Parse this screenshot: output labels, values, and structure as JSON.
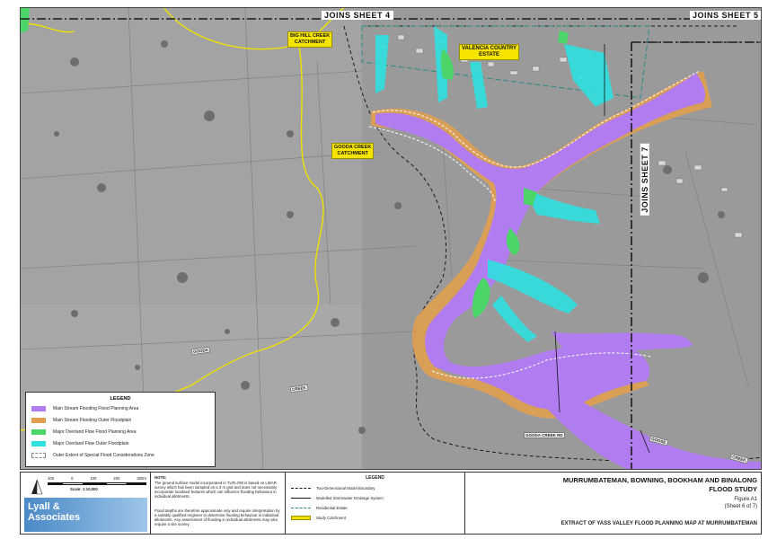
{
  "map": {
    "joins_top": "JOINS SHEET 4",
    "joins_top_right": "JOINS SHEET 5",
    "joins_right": "JOINS SHEET 7",
    "catchments": [
      "BIG HILL CREEK\nCATCHMENT",
      "GOODA CREEK\nCATCHMENT"
    ],
    "estate": "VALENCIA COUNTRY\nESTATE",
    "roads": [
      "GOODA",
      "CREEK",
      "GOODA CREEK RD",
      "GOOSE",
      "CREEK"
    ]
  },
  "legend": {
    "title": "LEGEND",
    "items": [
      {
        "label": "Main Stream Flooding Flood Planning Area",
        "color": "#b07cf0"
      },
      {
        "label": "Main Stream Flooding Outer Floodplain",
        "color": "#e0a050"
      },
      {
        "label": "Major Overland Flow Flood Planning Area",
        "color": "#4cd66a"
      },
      {
        "label": "Major Overland Flow Outer Floodplain",
        "color": "#2fe0e0"
      },
      {
        "label": "Outer Extent of Special Flood Considerations Zone",
        "color": "#ffffff"
      }
    ]
  },
  "footer": {
    "scale_ticks": [
      "100",
      "0",
      "100",
      "200",
      "300m"
    ],
    "scale_text": "Scale: 1:10,000",
    "company": "Lyall &\nAssociates",
    "note_title": "NOTE:",
    "note_text": "The ground surface model incorporated in TUFLOW is based on LiDAR survey which has been sampled on a 3 m grid and does not necessarily incorporate localised features which can influence flooding behaviour in individual allotments.",
    "note_text2": "Flood depths are therefore approximate only and require interpretation by a suitably qualified engineer to determine flooding behaviour in individual allotments. Any assessment of flooding in individual allotments may also require a site survey.",
    "legend_title": "LEGEND",
    "legend_items": [
      "Two-Dimensional Model Boundary",
      "Modelled Stormwater Drainage System",
      "Residential Estate",
      "Study Catchment"
    ],
    "study_title_1": "MURRUMBATEMAN, BOWNING, BOOKHAM AND BINALONG",
    "study_title_2": "FLOOD STUDY",
    "figure": "Figure A1",
    "sheet": "(Sheet 6 of 7)",
    "extract": "EXTRACT OF YASS VALLEY FLOOD PLANNING MAP AT MURRUMBATEMAN"
  },
  "colors": {
    "main_fpa": "#b07cf0",
    "main_outer": "#e0a050",
    "overland_fpa": "#4cd66a",
    "overland_outer": "#2fe0e0",
    "catchment": "#f0e000"
  }
}
